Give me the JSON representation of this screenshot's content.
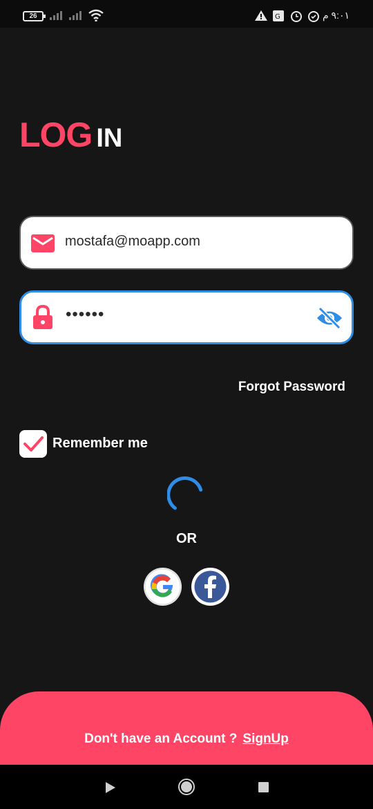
{
  "status_bar": {
    "battery": "26",
    "time": "٩:٠١ م",
    "icons": [
      "signal-icon",
      "signal-icon",
      "wifi-icon",
      "warning-icon",
      "translate-icon",
      "alarm-icon",
      "alarm-icon"
    ]
  },
  "title": {
    "part1": "LOG",
    "part2": "IN"
  },
  "email": {
    "value": "mostafa@moapp.com",
    "icon": "mail-icon"
  },
  "password": {
    "value": "••••••",
    "icon": "lock-icon",
    "toggle_icon": "eye-off-icon"
  },
  "forgot_password": "Forgot Password",
  "remember": {
    "label": "Remember me",
    "checked": true
  },
  "or_label": "OR",
  "social": [
    "google-icon",
    "facebook-icon"
  ],
  "signup": {
    "prompt": "Don't have an Account ?",
    "link": "SignUp"
  },
  "colors": {
    "accent": "#ff4566",
    "background": "#161616",
    "focus": "#2f8de6"
  },
  "nav": [
    "back-icon",
    "home-icon",
    "recents-icon"
  ]
}
